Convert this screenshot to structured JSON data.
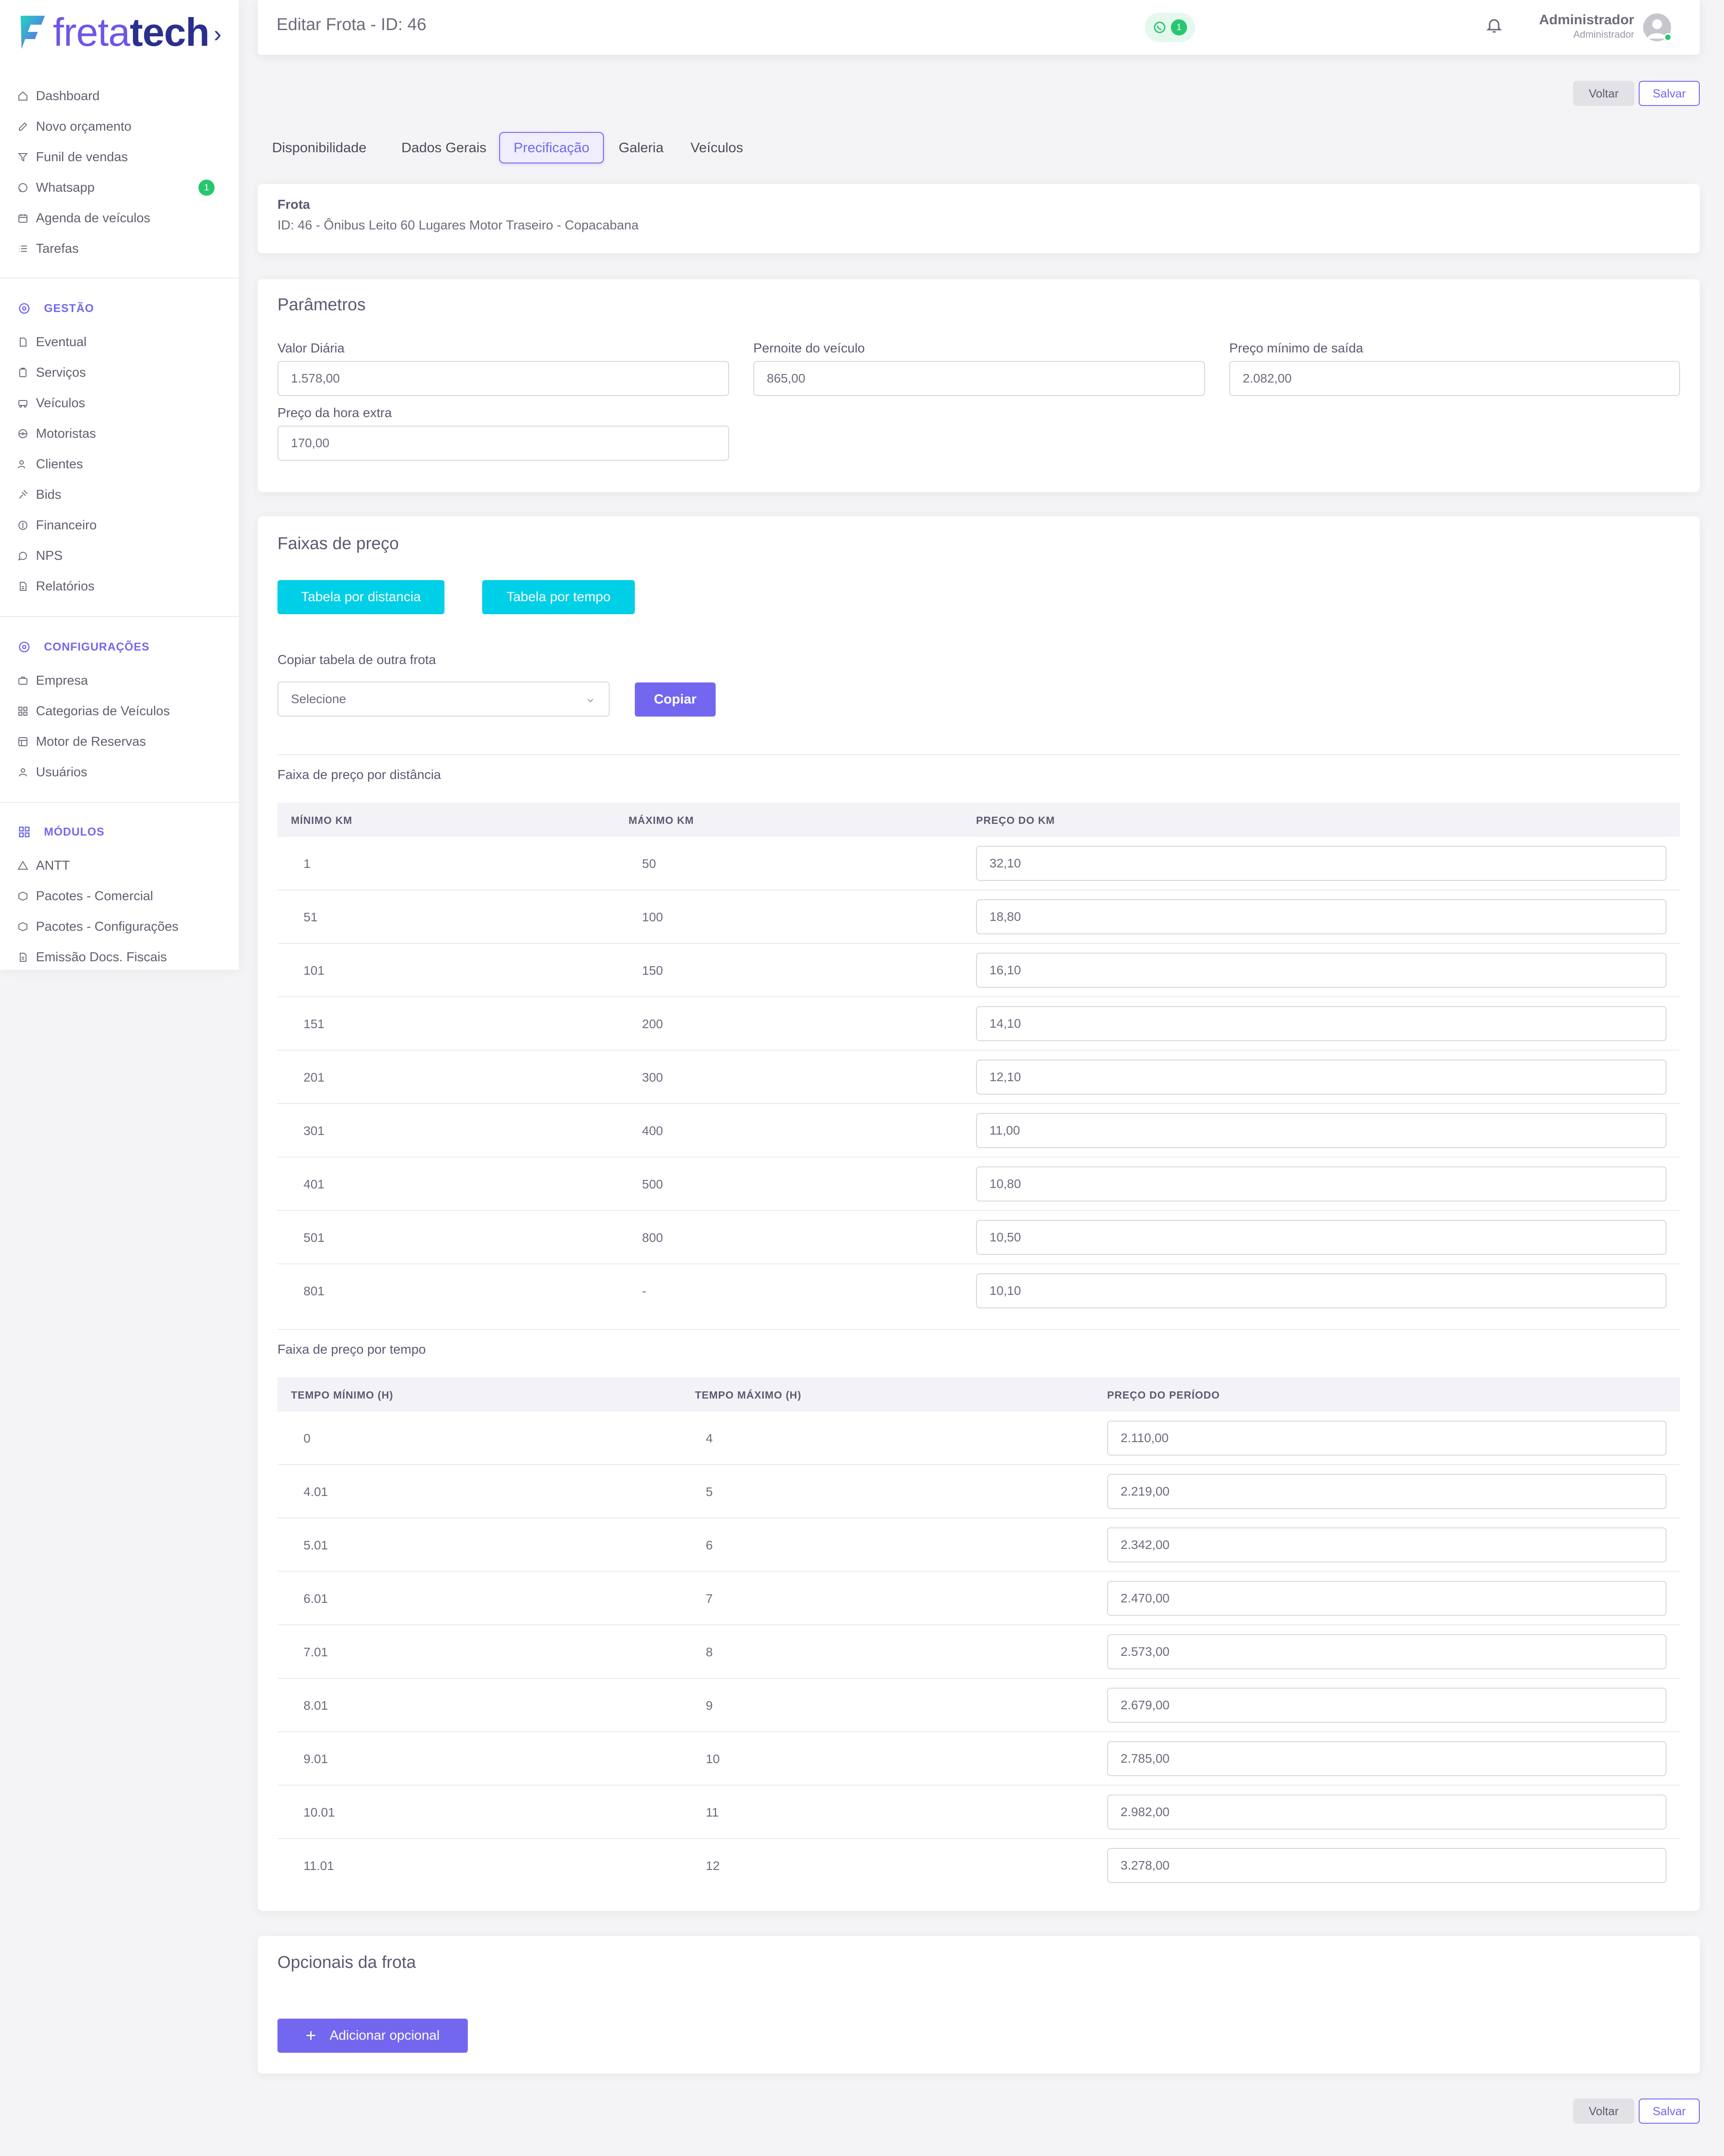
{
  "brand": {
    "name_light": "freta",
    "name_bold": "tech",
    "colors": {
      "primary": "#7367f0",
      "brand_dark": "#2a2f8f",
      "cyan": "#00cfe8",
      "success": "#28c76f"
    }
  },
  "sidebar": {
    "items": [
      {
        "label": "Dashboard",
        "icon": "home-icon"
      },
      {
        "label": "Novo orçamento",
        "icon": "edit-icon"
      },
      {
        "label": "Funil de vendas",
        "icon": "funnel-icon"
      },
      {
        "label": "Whatsapp",
        "icon": "whatsapp-icon",
        "badge": "1"
      },
      {
        "label": "Agenda de veículos",
        "icon": "calendar-icon"
      },
      {
        "label": "Tarefas",
        "icon": "list-icon"
      }
    ],
    "sections": [
      {
        "title": "GESTÃO",
        "items": [
          "Eventual",
          "Serviços",
          "Veículos",
          "Motoristas",
          "Clientes",
          "Bids",
          "Financeiro",
          "NPS",
          "Relatórios"
        ]
      },
      {
        "title": "CONFIGURAÇÕES",
        "items": [
          "Empresa",
          "Categorias de Veículos",
          "Motor de Reservas",
          "Usuários"
        ]
      },
      {
        "title": "MÓDULOS",
        "items": [
          "ANTT",
          "Pacotes - Comercial",
          "Pacotes - Configurações",
          "Emissão Docs. Fiscais"
        ]
      }
    ]
  },
  "header": {
    "title": "Editar Frota - ID: 46",
    "whatsapp_count": "1",
    "user_name": "Administrador",
    "user_role": "Administrador"
  },
  "actions": {
    "back": "Voltar",
    "save": "Salvar"
  },
  "tabs": [
    {
      "label": "Disponibilidade",
      "active": false
    },
    {
      "label": "Dados Gerais",
      "active": false
    },
    {
      "label": "Precificação",
      "active": true
    },
    {
      "label": "Galeria",
      "active": false
    },
    {
      "label": "Veículos",
      "active": false
    }
  ],
  "fleet": {
    "label": "Frota",
    "value": "ID: 46 - Ônibus Leito 60 Lugares Motor Traseiro - Copacabana"
  },
  "params": {
    "title": "Parâmetros",
    "daily_label": "Valor Diária",
    "daily_value": "1.578,00",
    "overnight_label": "Pernoite do veículo",
    "overnight_value": "865,00",
    "min_price_label": "Preço mínimo de saída",
    "min_price_value": "2.082,00",
    "overtime_label": "Preço da hora extra",
    "overtime_value": "170,00"
  },
  "price_ranges": {
    "title": "Faixas de preço",
    "btn_distance": "Tabela por distancia",
    "btn_time": "Tabela por tempo",
    "copy_label": "Copiar tabela de outra frota",
    "copy_placeholder": "Selecione",
    "copy_button": "Copiar",
    "distance": {
      "title": "Faixa de preço por distância",
      "headers": [
        "MÍNIMO KM",
        "MÁXIMO KM",
        "PREÇO DO KM"
      ],
      "rows": [
        [
          "1",
          "50",
          "32,10"
        ],
        [
          "51",
          "100",
          "18,80"
        ],
        [
          "101",
          "150",
          "16,10"
        ],
        [
          "151",
          "200",
          "14,10"
        ],
        [
          "201",
          "300",
          "12,10"
        ],
        [
          "301",
          "400",
          "11,00"
        ],
        [
          "401",
          "500",
          "10,80"
        ],
        [
          "501",
          "800",
          "10,50"
        ],
        [
          "801",
          "-",
          "10,10"
        ]
      ]
    },
    "time": {
      "title": "Faixa de preço por tempo",
      "headers": [
        "TEMPO MÍNIMO (H)",
        "TEMPO MÁXIMO (H)",
        "PREÇO DO PERÍODO"
      ],
      "rows": [
        [
          "0",
          "4",
          "2.110,00"
        ],
        [
          "4.01",
          "5",
          "2.219,00"
        ],
        [
          "5.01",
          "6",
          "2.342,00"
        ],
        [
          "6.01",
          "7",
          "2.470,00"
        ],
        [
          "7.01",
          "8",
          "2.573,00"
        ],
        [
          "8.01",
          "9",
          "2.679,00"
        ],
        [
          "9.01",
          "10",
          "2.785,00"
        ],
        [
          "10.01",
          "11",
          "2.982,00"
        ],
        [
          "11.01",
          "12",
          "3.278,00"
        ]
      ]
    }
  },
  "optionals": {
    "title": "Opcionais da frota",
    "add_button": "Adicionar opcional"
  }
}
